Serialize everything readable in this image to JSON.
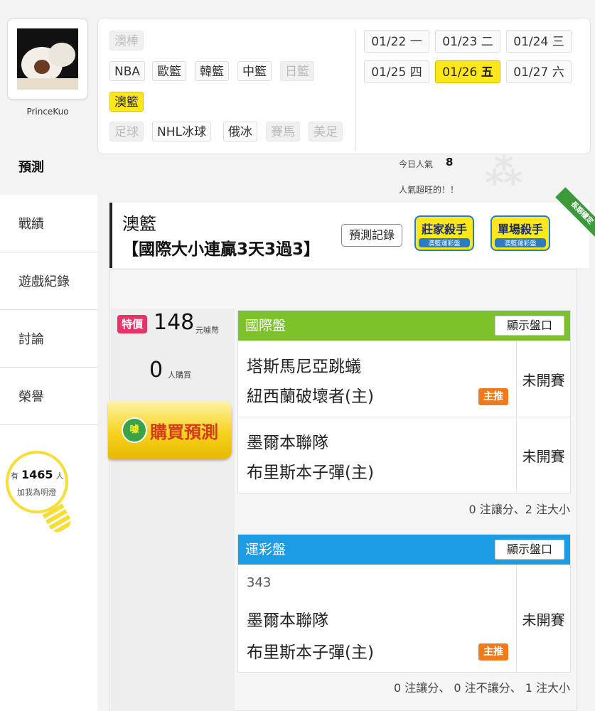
{
  "profile": {
    "username": "PrinceKuo"
  },
  "sidebar": {
    "items": [
      {
        "label": "預測",
        "active": true
      },
      {
        "label": "戰績",
        "active": false
      },
      {
        "label": "遊戲紀錄",
        "active": false
      },
      {
        "label": "討論",
        "active": false
      },
      {
        "label": "榮譽",
        "active": false
      }
    ],
    "likes": {
      "prefix": "有",
      "count": "1465",
      "suffix": "人",
      "caption": "加我為明燈"
    }
  },
  "sports": {
    "row1": [
      "澳棒"
    ],
    "row2": [
      "NBA",
      "歐籃",
      "韓籃",
      "中籃",
      "日籃"
    ],
    "row3": [
      "澳籃"
    ],
    "row4": [
      "足球",
      "NHL冰球",
      "俄冰",
      "賽馬",
      "美足"
    ],
    "disabled": [
      "澳棒",
      "日籃",
      "足球",
      "賽馬",
      "美足"
    ],
    "selected": "澳籃"
  },
  "dates": [
    {
      "date": "01/22",
      "day": "一",
      "selected": false
    },
    {
      "date": "01/23",
      "day": "二",
      "selected": false
    },
    {
      "date": "01/24",
      "day": "三",
      "selected": false
    },
    {
      "date": "01/25",
      "day": "四",
      "selected": false
    },
    {
      "date": "01/26",
      "day": "五",
      "selected": true
    },
    {
      "date": "01/27",
      "day": "六",
      "selected": false
    }
  ],
  "popularity": {
    "label": "今日人氣",
    "value": "8",
    "note": "人氣超旺的！！"
  },
  "prediction": {
    "sport": "澳籃",
    "title": "【國際大小連贏3天3過3】",
    "record_button": "預測記錄",
    "badges": [
      {
        "title": "莊家殺手",
        "sub": "澳籃運彩盤"
      },
      {
        "title": "單場殺手",
        "sub": "澳籃運彩盤"
      }
    ],
    "ribbon": "長期穩定"
  },
  "purchase": {
    "special_label": "特價",
    "price": "148",
    "price_unit": "元噱幣",
    "buyers": "0",
    "buyers_unit": "人購買",
    "buy_button": "購買預測",
    "buy_icon_text": "噱"
  },
  "markets": [
    {
      "name": "國際盤",
      "color": "#7dc22b",
      "show_button": "顯示盤口",
      "games": [
        {
          "home_note": "",
          "away": "塔斯馬尼亞跳蟻",
          "home": "紐西蘭破壞者(主)",
          "status": "未開賽",
          "pushed": "主推"
        },
        {
          "home_note": "",
          "away": "墨爾本聯隊",
          "home": "布里斯本子彈(主)",
          "status": "未開賽",
          "pushed": ""
        }
      ],
      "summary": "0 注讓分、2 注大小"
    },
    {
      "name": "運彩盤",
      "color": "#1c9de3",
      "show_button": "顯示盤口",
      "games": [
        {
          "game_no": "343",
          "away": "墨爾本聯隊",
          "home": "布里斯本子彈(主)",
          "status": "未開賽",
          "pushed": "主推"
        }
      ],
      "summary": "0 注讓分、 0 注不讓分、 1 注大小"
    }
  ]
}
